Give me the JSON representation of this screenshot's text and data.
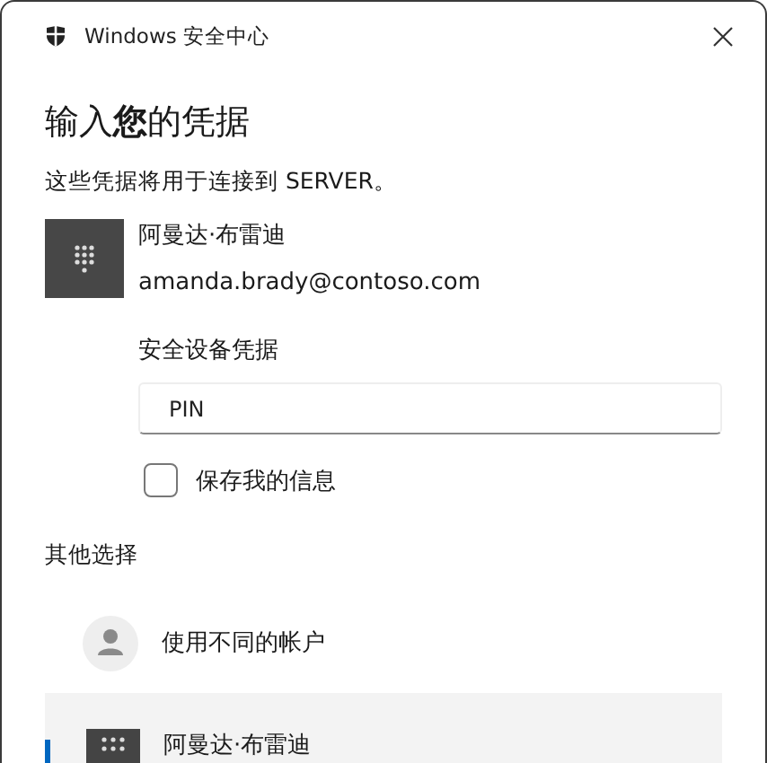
{
  "window": {
    "title": "Windows 安全中心"
  },
  "heading": "输入**您**的凭据",
  "subtitle": "这些凭据将用于连接到 SERVER。",
  "account": {
    "name": "阿曼达·布雷迪",
    "email": "amanda.brady@contoso.com"
  },
  "credential": {
    "label": "安全设备凭据",
    "value": "PIN"
  },
  "remember": {
    "label": "保存我的信息",
    "checked": false
  },
  "other_options": {
    "title": "其他选择",
    "items": [
      {
        "kind": "person",
        "label": "使用不同的帐户",
        "selected": false
      },
      {
        "kind": "keypad",
        "label": "阿曼达·布雷迪",
        "selected": true
      }
    ]
  }
}
